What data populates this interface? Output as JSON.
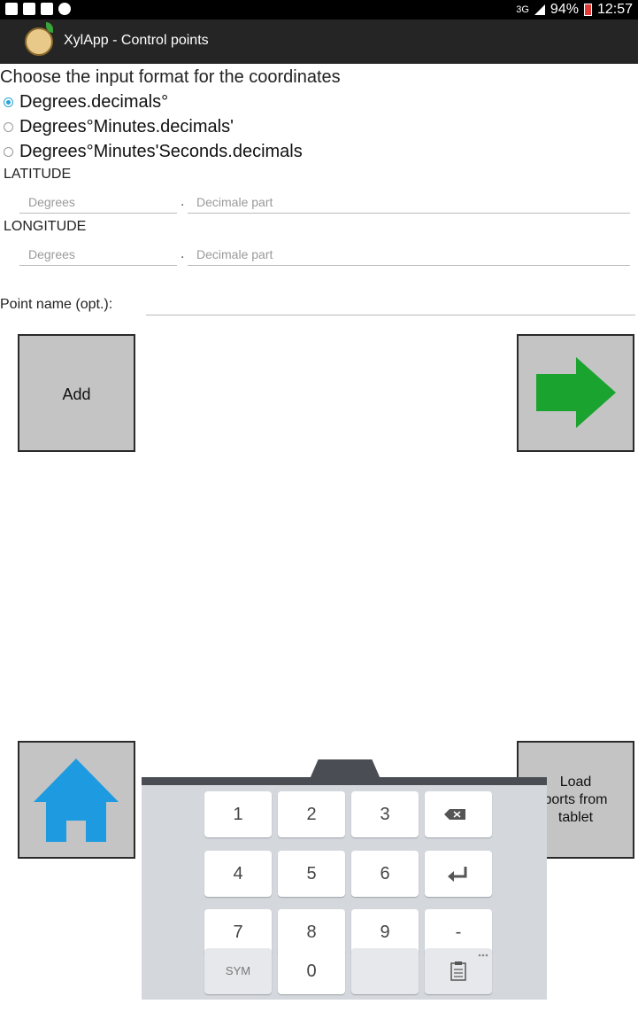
{
  "status_bar": {
    "signal": "3G",
    "battery": "94%",
    "time": "12:57"
  },
  "app_bar": {
    "title": "XylApp - Control points"
  },
  "form": {
    "prompt": "Choose the input format for the coordinates",
    "formats": [
      {
        "label": "Degrees.decimals°",
        "selected": true
      },
      {
        "label": "Degrees°Minutes.decimals'",
        "selected": false
      },
      {
        "label": "Degrees°Minutes'Seconds.decimals",
        "selected": false
      }
    ],
    "latitude": {
      "label": "LATITUDE",
      "degrees_placeholder": "Degrees",
      "separator": ".",
      "decimal_placeholder": "Decimale part"
    },
    "longitude": {
      "label": "LONGITUDE",
      "degrees_placeholder": "Degrees",
      "separator": ".",
      "decimal_placeholder": "Decimale part"
    },
    "point_name_label": "Point name (opt.):"
  },
  "buttons": {
    "add": "Add",
    "next_icon": "green-arrow-right-icon",
    "home_icon": "blue-home-icon",
    "load": [
      "Load",
      "ports from",
      "tablet"
    ]
  },
  "keyboard": {
    "rows": [
      [
        "1",
        "2",
        "3",
        "backspace"
      ],
      [
        "4",
        "5",
        "6",
        "enter"
      ],
      [
        "7",
        "8",
        "9",
        "-"
      ],
      [
        "SYM",
        "0",
        "",
        "clipboard"
      ]
    ]
  },
  "colors": {
    "accent_radio": "#29a6d8",
    "arrow_green": "#1aa32e",
    "home_blue": "#1e9be0",
    "app_bar": "#252525"
  }
}
